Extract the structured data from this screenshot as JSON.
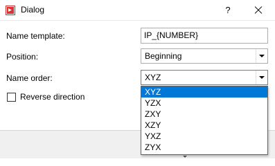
{
  "window": {
    "title": "Dialog",
    "help_label": "?",
    "close_icon": "close-icon",
    "app_icon": "app-icon"
  },
  "form": {
    "name_template": {
      "label": "Name template:",
      "value": "IP_{NUMBER}"
    },
    "position": {
      "label": "Position:",
      "value": "Beginning"
    },
    "name_order": {
      "label": "Name order:",
      "value": "XYZ"
    },
    "reverse_direction": {
      "label": "Reverse direction",
      "checked": false
    }
  },
  "dropdown": {
    "options": [
      "XYZ",
      "YZX",
      "ZXY",
      "XZY",
      "YXZ",
      "ZYX"
    ],
    "selected_index": 0
  },
  "colors": {
    "selection": "#0078d7",
    "app_icon": "#d9342b"
  }
}
